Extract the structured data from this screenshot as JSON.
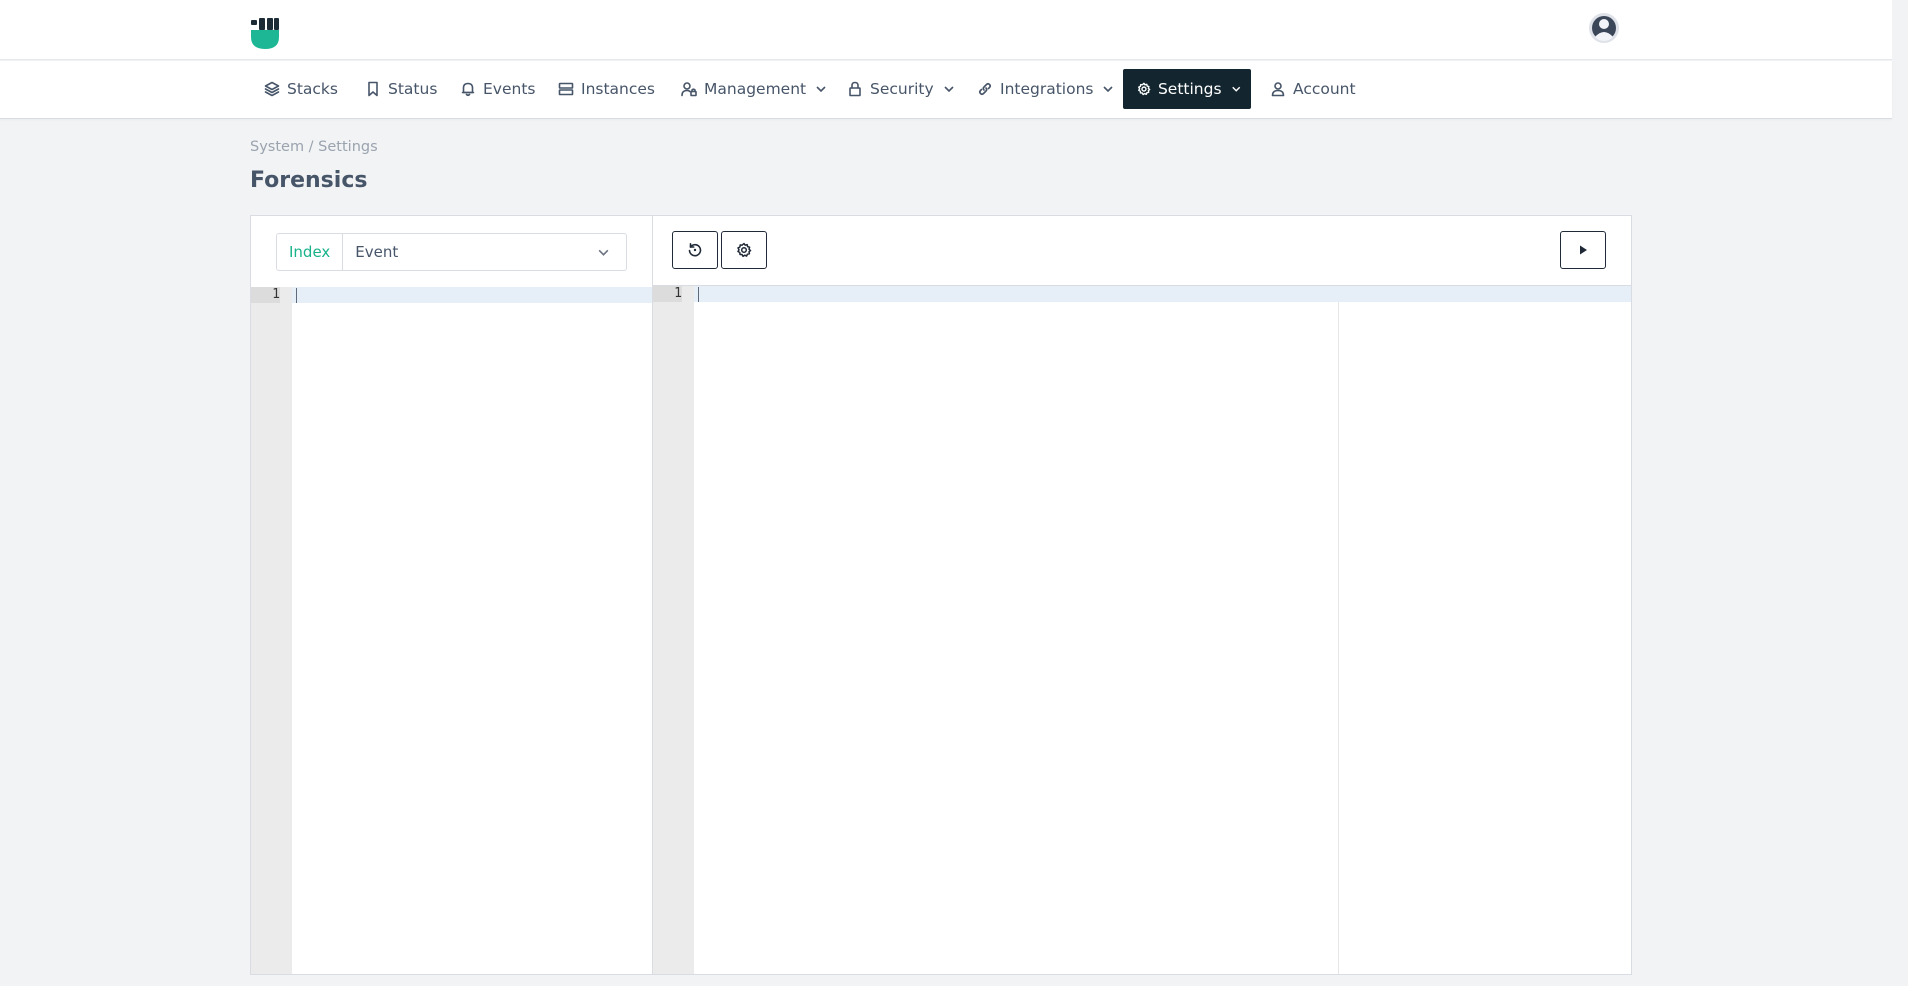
{
  "nav": {
    "items": [
      {
        "label": "Stacks",
        "icon": "layers-icon"
      },
      {
        "label": "Status",
        "icon": "bookmark-icon"
      },
      {
        "label": "Events",
        "icon": "bell-icon"
      },
      {
        "label": "Instances",
        "icon": "server-icon"
      },
      {
        "label": "Management",
        "icon": "user-lock-icon"
      },
      {
        "label": "Security",
        "icon": "lock-icon"
      },
      {
        "label": "Integrations",
        "icon": "link-icon"
      },
      {
        "label": "Settings",
        "icon": "gear-icon"
      },
      {
        "label": "Account",
        "icon": "user-icon"
      }
    ],
    "active": "Settings"
  },
  "breadcrumb": "System / Settings",
  "page_title": "Forensics",
  "index_selector": {
    "label": "Index",
    "value": "Event"
  },
  "query_editor": {
    "line_numbers": [
      "1"
    ]
  },
  "result_editor": {
    "line_numbers": [
      "1"
    ]
  },
  "colors": {
    "brand": "#19b28a",
    "active_nav": "#132630",
    "active_line": "#e6eef8"
  }
}
